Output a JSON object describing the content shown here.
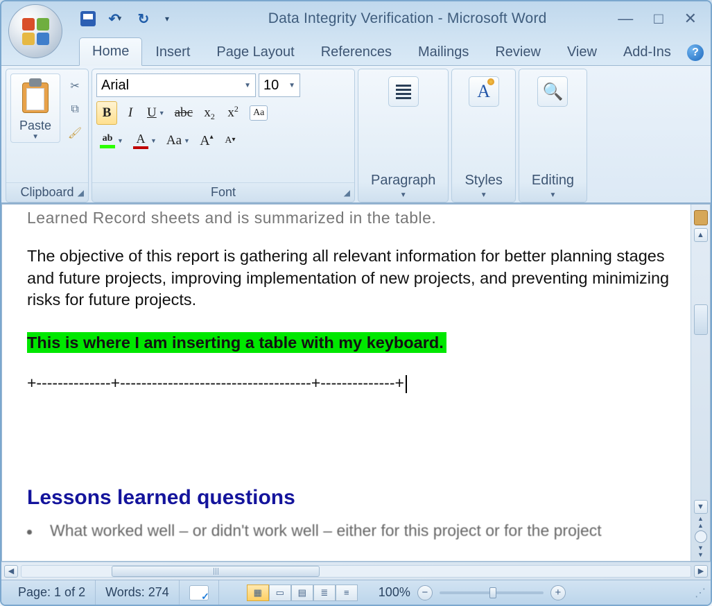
{
  "title": {
    "doc": "Data Integrity Verification",
    "sep": " - ",
    "app": "Microsoft Word"
  },
  "tabs": [
    "Home",
    "Insert",
    "Page Layout",
    "References",
    "Mailings",
    "Review",
    "View",
    "Add-Ins"
  ],
  "ribbon": {
    "clipboard": {
      "paste": "Paste",
      "label": "Clipboard"
    },
    "font": {
      "name": "Arial",
      "size": "10",
      "label": "Font",
      "bold": "B",
      "italic": "I",
      "underline": "U",
      "strike": "abc",
      "sub_base": "x",
      "sub_s": "2",
      "sup_base": "x",
      "sup_s": "2",
      "hl_glyph": "ab",
      "fc_glyph": "A",
      "case": "Aa",
      "grow": "A",
      "shrink": "A",
      "clearfmt": "Aa"
    },
    "paragraph": {
      "label": "Paragraph"
    },
    "styles": {
      "label": "Styles"
    },
    "editing": {
      "label": "Editing"
    }
  },
  "document": {
    "cut_top": "Learned Record sheets and is summarized in the table.",
    "para1": "The objective of this report is gathering all relevant information for better planning stages and future projects, improving implementation of new projects, and preventing minimizing risks for future projects.",
    "highlighted": "This is where I am inserting a table with my keyboard.",
    "table_ascii": "+--------------+------------------------------------+--------------+",
    "heading": "Lessons learned questions",
    "cut_bottom": "What worked well – or didn't work well – either for this project or for the project"
  },
  "status": {
    "page": "Page: 1 of 2",
    "words": "Words: 274",
    "zoom": "100%"
  }
}
